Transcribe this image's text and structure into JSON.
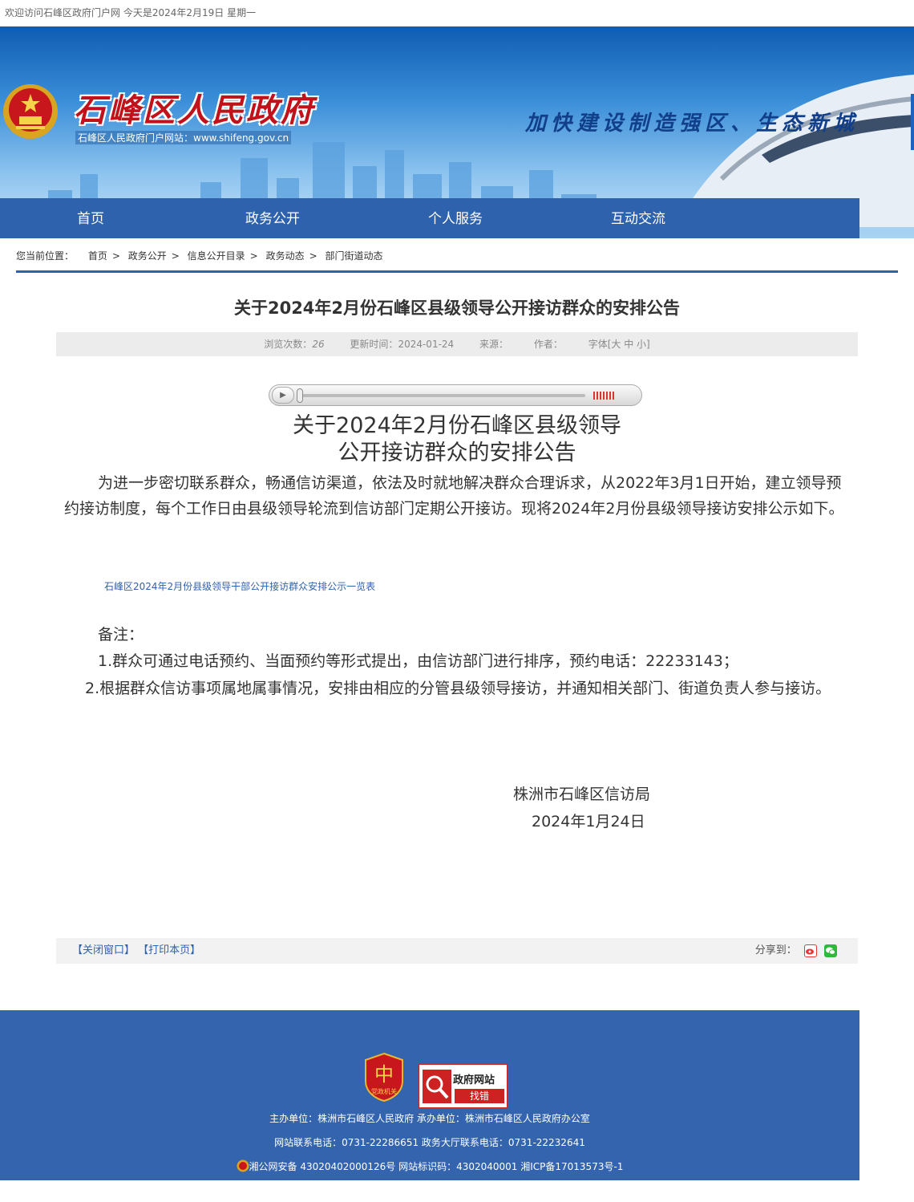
{
  "topbar": {
    "welcome": "欢迎访问石峰区政府门户网 今天是2024年2月19日 星期一"
  },
  "header": {
    "site_name": "石峰区人民政府",
    "site_url": "石峰区人民政府门户网站：www.shifeng.gov.cn",
    "slogan": "加快建设制造强区、生态新城"
  },
  "nav": {
    "items": [
      {
        "label": "首页"
      },
      {
        "label": "政务公开"
      },
      {
        "label": "个人服务"
      },
      {
        "label": "互动交流"
      }
    ]
  },
  "breadcrumb": {
    "prefix": "您当前位置：",
    "items": [
      "首页",
      "政务公开",
      "信息公开目录",
      "政务动态",
      "部门街道动态"
    ],
    "separator": ">"
  },
  "article": {
    "title": "关于2024年2月份石峰区县级领导公开接访群众的安排公告",
    "meta": {
      "views_label": "浏览次数：",
      "views": "26",
      "updated_label": "更新时间：",
      "updated": "2024-01-24",
      "source_label": "来源：",
      "author_label": "作者：",
      "font_label": "字体[大 中 小]"
    },
    "heading_line1": "关于2024年2月份石峰区县级领导",
    "heading_line2": "公开接访群众的安排公告",
    "intro": "为进一步密切联系群众，畅通信访渠道，依法及时就地解决群众合理诉求，从2022年3月1日开始，建立领导预约接访制度，每个工作日由县级领导轮流到信访部门定期公开接访。现将2024年2月份县级领导接访安排公示如下。",
    "attachment": "石峰区2024年2月份县级领导干部公开接访群众安排公示一览表",
    "note_label": "备注：",
    "note1": "1.群众可通过电话预约、当面预约等形式提出，由信访部门进行排序，预约电话：22233143；",
    "note2": "2.根据群众信访事项属地属事情况，安排由相应的分管县级领导接访，并通知相关部门、街道负责人参与接访。",
    "sign_org": "株洲市石峰区信访局",
    "sign_date": "2024年1月24日"
  },
  "tools": {
    "close": "【关闭窗口】",
    "print": "【打印本页】",
    "share_label": "分享到：",
    "share_icons": [
      "weibo-icon",
      "wechat-icon"
    ]
  },
  "footer": {
    "party_badge": "党政机关",
    "error_title": "政府网站",
    "error_button": "找错",
    "sponsor": "主办单位：株洲市石峰区人民政府 承办单位：株洲市石峰区人民政府办公室",
    "contact": "网站联系电话：0731-22286651 政务大厅联系电话：0731-22232641",
    "icp": "湘公网安备 43020402000126号 网站标识码：4302040001 湘ICP备17013573号-1"
  },
  "colors": {
    "nav": "#2f62ad",
    "footer": "#3364ad",
    "brand_red": "#c1121b"
  }
}
